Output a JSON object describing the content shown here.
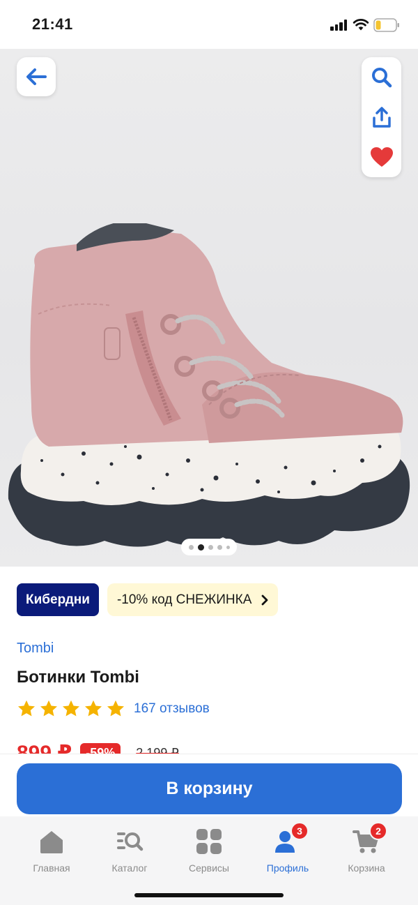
{
  "status_bar": {
    "time": "21:41"
  },
  "gallery": {
    "image_alt": "pink-ankle-boot",
    "dots_count": 5,
    "active_dot": 1
  },
  "badges": {
    "partner": "Кибердни",
    "promo": "-10% код СНЕЖИНКА"
  },
  "product": {
    "brand": "Tombi",
    "title": "Ботинки Tombi",
    "rating_stars": 5,
    "reviews": "167 отзывов",
    "price": "899 ₽",
    "discount": "-59%",
    "old_price": "2 199 ₽"
  },
  "cart_button": "В корзину",
  "nav": {
    "home": "Главная",
    "catalog": "Каталог",
    "services": "Сервисы",
    "profile": "Профиль",
    "profile_badge": "3",
    "cart": "Корзина",
    "cart_badge": "2"
  },
  "colors": {
    "accent": "#2b6fd6",
    "sale": "#e52a2a",
    "partner": "#0b1b7a",
    "star": "#f5b300"
  }
}
